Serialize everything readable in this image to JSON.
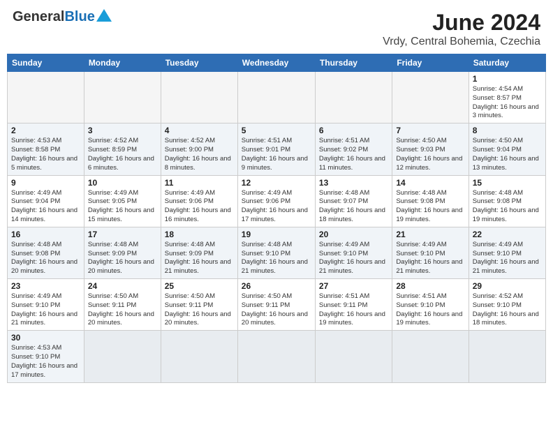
{
  "header": {
    "logo_general": "General",
    "logo_blue": "Blue",
    "month_year": "June 2024",
    "location": "Vrdy, Central Bohemia, Czechia"
  },
  "days_of_week": [
    "Sunday",
    "Monday",
    "Tuesday",
    "Wednesday",
    "Thursday",
    "Friday",
    "Saturday"
  ],
  "weeks": [
    {
      "days": [
        {
          "num": "",
          "info": ""
        },
        {
          "num": "",
          "info": ""
        },
        {
          "num": "",
          "info": ""
        },
        {
          "num": "",
          "info": ""
        },
        {
          "num": "",
          "info": ""
        },
        {
          "num": "",
          "info": ""
        },
        {
          "num": "1",
          "info": "Sunrise: 4:54 AM\nSunset: 8:57 PM\nDaylight: 16 hours\nand 3 minutes."
        }
      ]
    },
    {
      "days": [
        {
          "num": "2",
          "info": "Sunrise: 4:53 AM\nSunset: 8:58 PM\nDaylight: 16 hours\nand 5 minutes."
        },
        {
          "num": "3",
          "info": "Sunrise: 4:52 AM\nSunset: 8:59 PM\nDaylight: 16 hours\nand 6 minutes."
        },
        {
          "num": "4",
          "info": "Sunrise: 4:52 AM\nSunset: 9:00 PM\nDaylight: 16 hours\nand 8 minutes."
        },
        {
          "num": "5",
          "info": "Sunrise: 4:51 AM\nSunset: 9:01 PM\nDaylight: 16 hours\nand 9 minutes."
        },
        {
          "num": "6",
          "info": "Sunrise: 4:51 AM\nSunset: 9:02 PM\nDaylight: 16 hours\nand 11 minutes."
        },
        {
          "num": "7",
          "info": "Sunrise: 4:50 AM\nSunset: 9:03 PM\nDaylight: 16 hours\nand 12 minutes."
        },
        {
          "num": "8",
          "info": "Sunrise: 4:50 AM\nSunset: 9:04 PM\nDaylight: 16 hours\nand 13 minutes."
        }
      ]
    },
    {
      "days": [
        {
          "num": "9",
          "info": "Sunrise: 4:49 AM\nSunset: 9:04 PM\nDaylight: 16 hours\nand 14 minutes."
        },
        {
          "num": "10",
          "info": "Sunrise: 4:49 AM\nSunset: 9:05 PM\nDaylight: 16 hours\nand 15 minutes."
        },
        {
          "num": "11",
          "info": "Sunrise: 4:49 AM\nSunset: 9:06 PM\nDaylight: 16 hours\nand 16 minutes."
        },
        {
          "num": "12",
          "info": "Sunrise: 4:49 AM\nSunset: 9:06 PM\nDaylight: 16 hours\nand 17 minutes."
        },
        {
          "num": "13",
          "info": "Sunrise: 4:48 AM\nSunset: 9:07 PM\nDaylight: 16 hours\nand 18 minutes."
        },
        {
          "num": "14",
          "info": "Sunrise: 4:48 AM\nSunset: 9:08 PM\nDaylight: 16 hours\nand 19 minutes."
        },
        {
          "num": "15",
          "info": "Sunrise: 4:48 AM\nSunset: 9:08 PM\nDaylight: 16 hours\nand 19 minutes."
        }
      ]
    },
    {
      "days": [
        {
          "num": "16",
          "info": "Sunrise: 4:48 AM\nSunset: 9:08 PM\nDaylight: 16 hours\nand 20 minutes."
        },
        {
          "num": "17",
          "info": "Sunrise: 4:48 AM\nSunset: 9:09 PM\nDaylight: 16 hours\nand 20 minutes."
        },
        {
          "num": "18",
          "info": "Sunrise: 4:48 AM\nSunset: 9:09 PM\nDaylight: 16 hours\nand 21 minutes."
        },
        {
          "num": "19",
          "info": "Sunrise: 4:48 AM\nSunset: 9:10 PM\nDaylight: 16 hours\nand 21 minutes."
        },
        {
          "num": "20",
          "info": "Sunrise: 4:49 AM\nSunset: 9:10 PM\nDaylight: 16 hours\nand 21 minutes."
        },
        {
          "num": "21",
          "info": "Sunrise: 4:49 AM\nSunset: 9:10 PM\nDaylight: 16 hours\nand 21 minutes."
        },
        {
          "num": "22",
          "info": "Sunrise: 4:49 AM\nSunset: 9:10 PM\nDaylight: 16 hours\nand 21 minutes."
        }
      ]
    },
    {
      "days": [
        {
          "num": "23",
          "info": "Sunrise: 4:49 AM\nSunset: 9:10 PM\nDaylight: 16 hours\nand 21 minutes."
        },
        {
          "num": "24",
          "info": "Sunrise: 4:50 AM\nSunset: 9:11 PM\nDaylight: 16 hours\nand 20 minutes."
        },
        {
          "num": "25",
          "info": "Sunrise: 4:50 AM\nSunset: 9:11 PM\nDaylight: 16 hours\nand 20 minutes."
        },
        {
          "num": "26",
          "info": "Sunrise: 4:50 AM\nSunset: 9:11 PM\nDaylight: 16 hours\nand 20 minutes."
        },
        {
          "num": "27",
          "info": "Sunrise: 4:51 AM\nSunset: 9:11 PM\nDaylight: 16 hours\nand 19 minutes."
        },
        {
          "num": "28",
          "info": "Sunrise: 4:51 AM\nSunset: 9:10 PM\nDaylight: 16 hours\nand 19 minutes."
        },
        {
          "num": "29",
          "info": "Sunrise: 4:52 AM\nSunset: 9:10 PM\nDaylight: 16 hours\nand 18 minutes."
        }
      ]
    },
    {
      "days": [
        {
          "num": "30",
          "info": "Sunrise: 4:53 AM\nSunset: 9:10 PM\nDaylight: 16 hours\nand 17 minutes."
        },
        {
          "num": "",
          "info": ""
        },
        {
          "num": "",
          "info": ""
        },
        {
          "num": "",
          "info": ""
        },
        {
          "num": "",
          "info": ""
        },
        {
          "num": "",
          "info": ""
        },
        {
          "num": "",
          "info": ""
        }
      ]
    }
  ]
}
